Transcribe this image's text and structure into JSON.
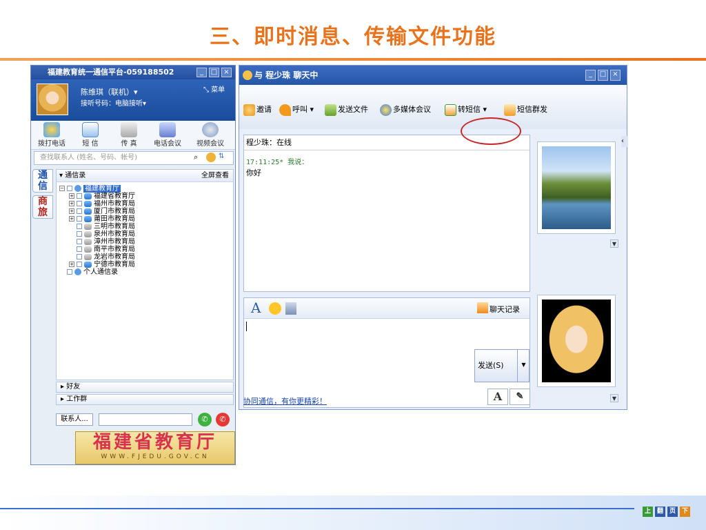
{
  "slide": {
    "title": "三、即时消息、传输文件功能",
    "nav_buttons": [
      "上",
      "翻",
      "页",
      "下"
    ]
  },
  "contacts_window": {
    "title": "福建教育统一通信平台-059188502",
    "controls": [
      "_",
      "□",
      "×"
    ],
    "user": {
      "name": "陈维琪（联机）▾",
      "listen": "接听号码：电脑接听▾",
      "menu": "⤡ 菜单"
    },
    "tools": [
      "拨打电话",
      "短 信",
      "传 真",
      "电话会议",
      "视频会议"
    ],
    "search_placeholder": "查找联系人 (姓名、号码、帐号)",
    "side_tabs": [
      "通\n信",
      "商\n旅"
    ],
    "tree_header": "▾ 通信录",
    "tree_fullview": "全屏查看",
    "root": "福建教育厅",
    "nodes": [
      "福建省教育厅",
      "福州市教育局",
      "厦门市教育局",
      "莆田市教育局",
      "三明市教育局",
      "泉州市教育局",
      "漳州市教育局",
      "南平市教育局",
      "龙岩市教育局",
      "宁德市教育局"
    ],
    "personal": "个人通信录",
    "groups": [
      "▸ 好友",
      "▸ 工作群"
    ],
    "contact_button": "联系人...",
    "banner_title": "福建省教育厅",
    "banner_url": "WWW.FJEDU.GOV.CN"
  },
  "chat_window": {
    "title": "与 程少珠 聊天中",
    "tools": [
      "邀请",
      "呼叫 ▾",
      "发送文件",
      "多媒体会议",
      "转短信 ▾",
      "短信群发"
    ],
    "status": "程少珠：在线",
    "message_meta": "17:11:25* 我说：",
    "message_text": "你好",
    "history": "聊天记录",
    "send": "发送(S)",
    "footer_link": "协同通信，有你更精彩！",
    "font_a": "A",
    "font_b": "A"
  },
  "colors": {
    "title": "#e8731c",
    "window": "#2656a8",
    "link": "#1a46b8",
    "highlight": "#c62828"
  }
}
